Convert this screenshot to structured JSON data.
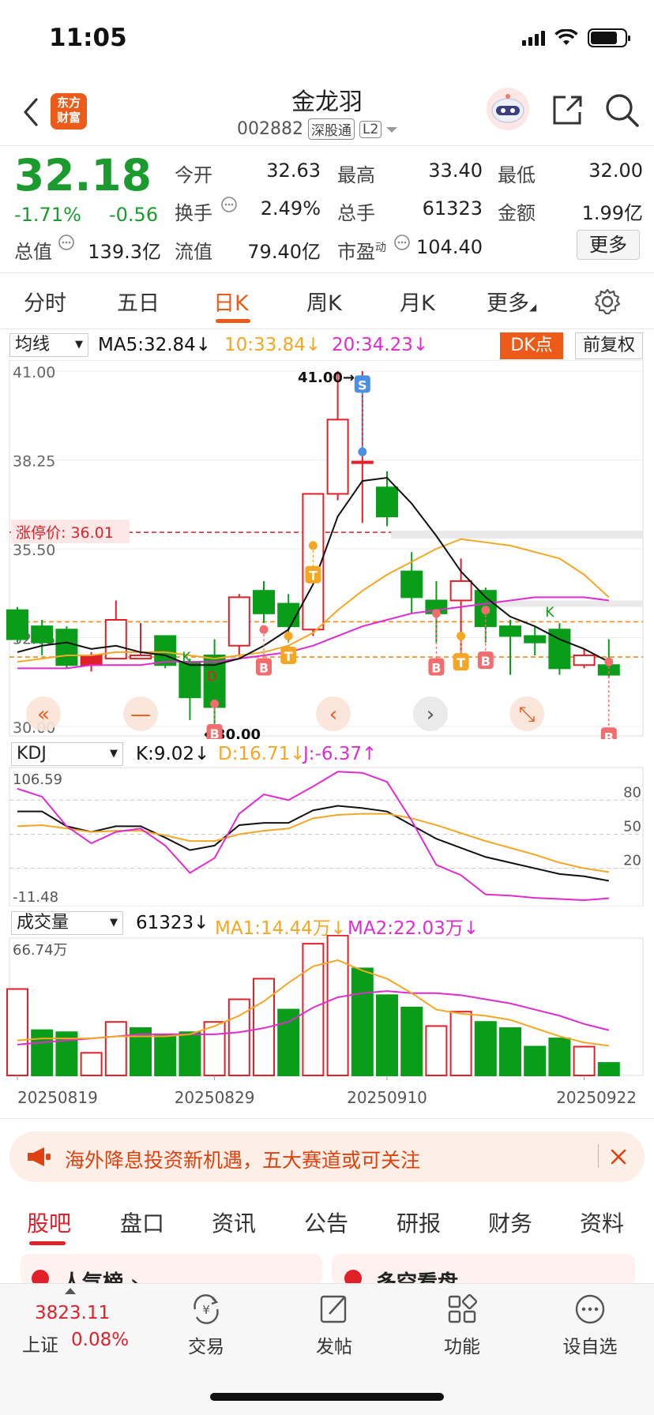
{
  "status_bar": {
    "time": "11:05"
  },
  "header": {
    "title": "金龙羽",
    "code": "002882",
    "tag1": "深股通",
    "tag2": "L2",
    "logo_line1": "东方",
    "logo_line2": "财富"
  },
  "quote": {
    "price": "32.18",
    "change_pct": "-1.71%",
    "change": "-0.56",
    "open_label": "今开",
    "open": "32.63",
    "high_label": "最高",
    "high": "33.40",
    "low_label": "最低",
    "low": "32.00",
    "turnover_label": "换手",
    "turnover": "2.49%",
    "volume_label": "总手",
    "volume": "61323",
    "amount_label": "金额",
    "amount": "1.99亿",
    "mktcap_label": "总值",
    "mktcap": "139.3亿",
    "float_label": "流值",
    "float": "79.40亿",
    "pe_label": "市盈",
    "pe_sup": "动",
    "pe": "104.40",
    "more": "更多"
  },
  "tabs": [
    "分时",
    "五日",
    "日K",
    "周K",
    "月K",
    "更多"
  ],
  "active_tab": "日K",
  "main_chart": {
    "indicator": "均线",
    "ma5": "MA5:32.84↓",
    "ma10": "10:33.84↓",
    "ma20": "20:34.23↓",
    "dk_button": "DK点",
    "adjust_button": "前复权",
    "y_labels": [
      "41.00",
      "38.25",
      "35.50",
      "32.75",
      "30.00"
    ],
    "limit_label": "涨停价: 36.01",
    "max_label": "41.00→",
    "min_label": "←30.00",
    "colors": {
      "up": "#e0212a",
      "down": "#0a9d1a",
      "ma5": "#111111",
      "ma10": "#f5a623",
      "ma20": "#e02bd0"
    }
  },
  "kdj": {
    "indicator": "KDJ",
    "k": "K:9.02↓",
    "d": "D:16.71↓",
    "j": "J:-6.37↑",
    "top": "106.59",
    "bottom": "-11.48",
    "levels": [
      "80",
      "50",
      "20"
    ]
  },
  "volume": {
    "indicator": "成交量",
    "value": "61323↓",
    "ma1": "MA1:14.44万↓",
    "ma2": "MA2:22.03万↓",
    "top": "66.74万"
  },
  "dates": [
    "20250819",
    "20250829",
    "20250910",
    "20250922"
  ],
  "banner": {
    "text": "海外降息投资新机遇，五大赛道或可关注"
  },
  "bottom_tabs": [
    "股吧",
    "盘口",
    "资讯",
    "公告",
    "研报",
    "财务",
    "资料"
  ],
  "peek": [
    "人气榜 ›",
    "多空看盘"
  ],
  "bottom_nav": {
    "index_value": "3823.11",
    "index_name": "上证",
    "index_pct": "0.08%",
    "items": [
      "交易",
      "发帖",
      "功能",
      "设自选"
    ]
  },
  "chart_data": [
    {
      "type": "candlestick",
      "title": "",
      "ylim": [
        30.0,
        41.0
      ],
      "candles": [
        {
          "o": 33.6,
          "c": 32.7,
          "h": 33.7,
          "l": 32.6
        },
        {
          "o": 33.1,
          "c": 32.6,
          "h": 33.3,
          "l": 32.2
        },
        {
          "o": 33.0,
          "c": 31.9,
          "h": 33.1,
          "l": 31.8
        },
        {
          "o": 31.9,
          "c": 32.2,
          "h": 32.3,
          "l": 31.7
        },
        {
          "o": 32.1,
          "c": 33.3,
          "h": 33.9,
          "l": 32.1
        },
        {
          "o": 32.1,
          "c": 32.2,
          "h": 33.2,
          "l": 32.1
        },
        {
          "o": 32.8,
          "c": 31.9,
          "h": 32.8,
          "l": 31.8
        },
        {
          "o": 32.0,
          "c": 30.9,
          "h": 32.1,
          "l": 30.2
        },
        {
          "o": 32.2,
          "c": 30.6,
          "h": 32.7,
          "l": 30.0
        },
        {
          "o": 32.5,
          "c": 34.0,
          "h": 34.1,
          "l": 32.2
        },
        {
          "o": 34.2,
          "c": 33.5,
          "h": 34.5,
          "l": 33.2
        },
        {
          "o": 33.8,
          "c": 33.1,
          "h": 34.1,
          "l": 32.6
        },
        {
          "o": 33.0,
          "c": 37.2,
          "h": 37.2,
          "l": 32.8
        },
        {
          "o": 37.2,
          "c": 39.5,
          "h": 41.0,
          "l": 37.0
        },
        {
          "o": 38.2,
          "c": 38.2,
          "h": 41.0,
          "l": 36.3
        },
        {
          "o": 37.4,
          "c": 36.5,
          "h": 37.9,
          "l": 36.2
        },
        {
          "o": 34.8,
          "c": 34.0,
          "h": 35.4,
          "l": 33.5
        },
        {
          "o": 33.9,
          "c": 33.5,
          "h": 34.5,
          "l": 32.6
        },
        {
          "o": 33.9,
          "c": 34.5,
          "h": 35.2,
          "l": 32.2
        },
        {
          "o": 34.2,
          "c": 33.1,
          "h": 34.3,
          "l": 32.6
        },
        {
          "o": 33.1,
          "c": 32.8,
          "h": 33.3,
          "l": 31.6
        },
        {
          "o": 32.8,
          "c": 32.6,
          "h": 33.1,
          "l": 32.2
        },
        {
          "o": 33.0,
          "c": 31.8,
          "h": 33.2,
          "l": 31.6
        },
        {
          "o": 31.9,
          "c": 32.2,
          "h": 32.4,
          "l": 31.8
        },
        {
          "o": 31.9,
          "c": 31.6,
          "h": 32.7,
          "l": 31.5
        }
      ],
      "ma5": [
        32.3,
        32.5,
        32.6,
        32.4,
        32.5,
        32.3,
        32.2,
        31.9,
        31.9,
        32.1,
        32.5,
        33.0,
        34.4,
        36.5,
        37.6,
        37.7,
        36.9,
        35.9,
        34.8,
        34.0,
        33.4,
        33.1,
        32.7,
        32.4,
        32.0
      ],
      "ma10": [
        32.0,
        32.1,
        32.2,
        32.2,
        32.3,
        32.3,
        32.3,
        32.2,
        32.1,
        32.2,
        32.3,
        32.5,
        32.9,
        33.6,
        34.2,
        34.7,
        35.1,
        35.5,
        35.8,
        35.7,
        35.6,
        35.4,
        35.2,
        34.7,
        34.0
      ],
      "ma20": [
        31.8,
        31.8,
        31.8,
        31.9,
        31.9,
        31.9,
        32.0,
        32.0,
        32.0,
        32.1,
        32.2,
        32.3,
        32.5,
        32.8,
        33.1,
        33.3,
        33.5,
        33.6,
        33.7,
        33.8,
        33.9,
        34.0,
        34.0,
        34.0,
        33.9
      ],
      "limit_price": 36.01,
      "ref_lines": [
        33.24,
        32.15
      ]
    },
    {
      "type": "line",
      "title": "",
      "ylim": [
        -11.48,
        106.59
      ],
      "series": [
        {
          "name": "K",
          "values": [
            70,
            70,
            57,
            52,
            57,
            57,
            47,
            36,
            40,
            58,
            60,
            60,
            71,
            75,
            73,
            70,
            58,
            46,
            38,
            30,
            25,
            20,
            15,
            13,
            9.02
          ]
        },
        {
          "name": "D",
          "values": [
            57,
            58,
            55,
            52,
            53,
            53,
            49,
            44,
            44,
            50,
            53,
            55,
            64,
            67,
            68,
            68,
            64,
            58,
            51,
            44,
            38,
            32,
            25,
            20,
            16.71
          ]
        },
        {
          "name": "J",
          "values": [
            90,
            83,
            57,
            42,
            52,
            55,
            40,
            16,
            29,
            68,
            85,
            80,
            92,
            105,
            104,
            96,
            62,
            23,
            14,
            -3,
            -4,
            -6,
            -7,
            -8,
            -6.37
          ]
        }
      ]
    },
    {
      "type": "bar",
      "title": "",
      "ylim": [
        0,
        66.74
      ],
      "unit": "万",
      "values": [
        42,
        22,
        21,
        11,
        26,
        23,
        20,
        21,
        26,
        37,
        47,
        32,
        64,
        68,
        52,
        39,
        33,
        24,
        31,
        26,
        23,
        14,
        18,
        14,
        6.1
      ],
      "up": [
        true,
        false,
        false,
        true,
        true,
        false,
        false,
        false,
        true,
        true,
        true,
        false,
        true,
        true,
        false,
        false,
        false,
        true,
        true,
        false,
        false,
        false,
        false,
        true,
        false
      ],
      "ma1": [
        17,
        18,
        18,
        18,
        19,
        19,
        19,
        20,
        24,
        29,
        36,
        45,
        53,
        56,
        51,
        47,
        40,
        32,
        30,
        29,
        27,
        23,
        19,
        16,
        14.4
      ],
      "ma2": [
        15,
        16,
        17,
        18,
        19,
        20,
        20,
        20,
        20,
        21,
        23,
        26,
        33,
        38,
        40,
        41,
        40,
        40,
        39,
        37,
        35,
        32,
        29,
        25,
        22.0
      ]
    }
  ]
}
